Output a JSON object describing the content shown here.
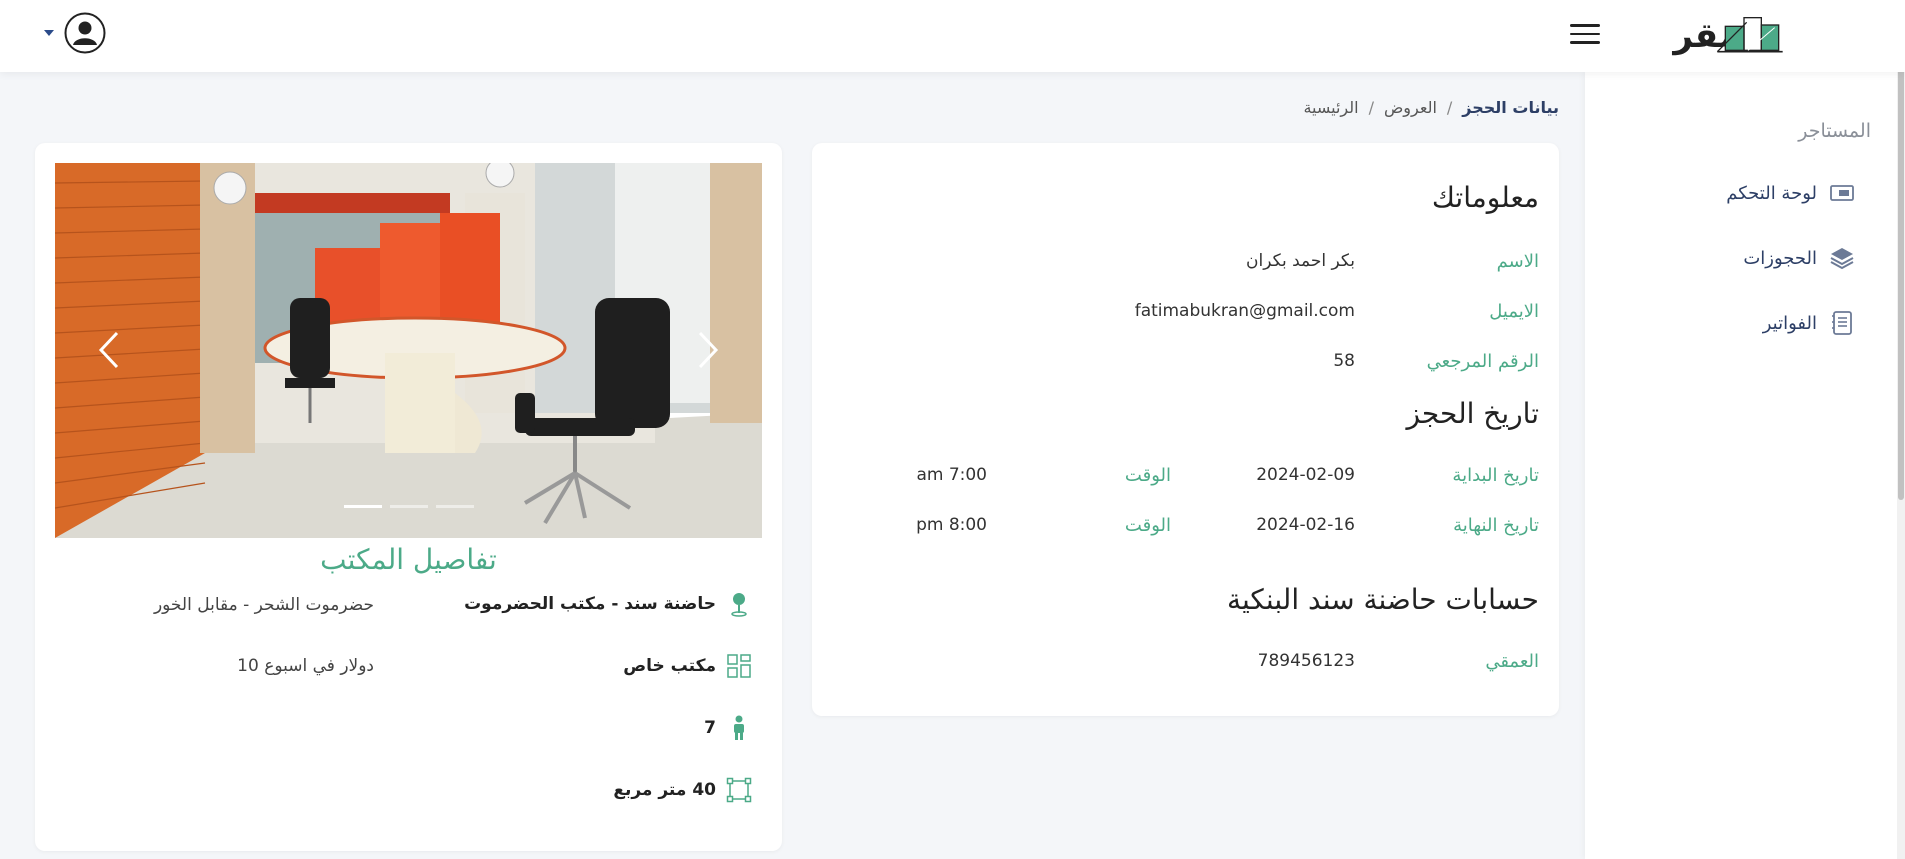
{
  "header": {
    "logo_text": "مقر"
  },
  "sidebar": {
    "heading": "المستاجر",
    "items": [
      {
        "label": "لوحة التحكم",
        "icon": "dashboard-monitor-icon"
      },
      {
        "label": "الحجوزات",
        "icon": "layers-icon"
      },
      {
        "label": "الفواتير",
        "icon": "invoice-icon"
      }
    ]
  },
  "breadcrumb": {
    "home": "الرئيسية",
    "offers": "العروض",
    "current": "بيانات الحجز",
    "separator": "/"
  },
  "info": {
    "title": "معلوماتك",
    "name_label": "الاسم",
    "name_value": "بكر احمد بكران",
    "email_label": "الايميل",
    "email_value": "fatimabukran@gmail.com",
    "ref_label": "الرقم المرجعي",
    "ref_value": "58"
  },
  "booking": {
    "title": "تاريخ الحجز",
    "start_label": "تاريخ البداية",
    "start_date": "2024-02-09",
    "start_time_label": "الوقت",
    "start_time": "am 7:00",
    "end_label": "تاريخ النهاية",
    "end_date": "2024-02-16",
    "end_time_label": "الوقت",
    "end_time": "pm 8:00"
  },
  "accounts": {
    "title": "حسابات حاضنة سند البنكية",
    "bank_label": "العمقي",
    "bank_value": "789456123"
  },
  "office": {
    "title": "تفاصيل المكتب",
    "name": "حاضنة سند - مكتب الحضرموت",
    "address": "حضرموت الشحر - مقابل الخور",
    "type": "مكتب خاص",
    "price": "10 دولار في اسبوع",
    "capacity": "7",
    "area": "40 متر مربع"
  },
  "carousel": {
    "slide_count": 3,
    "active_slide": 1
  },
  "colors": {
    "accent": "#4caa88",
    "nav_text": "#2d3f66",
    "background": "#f4f6f9"
  }
}
